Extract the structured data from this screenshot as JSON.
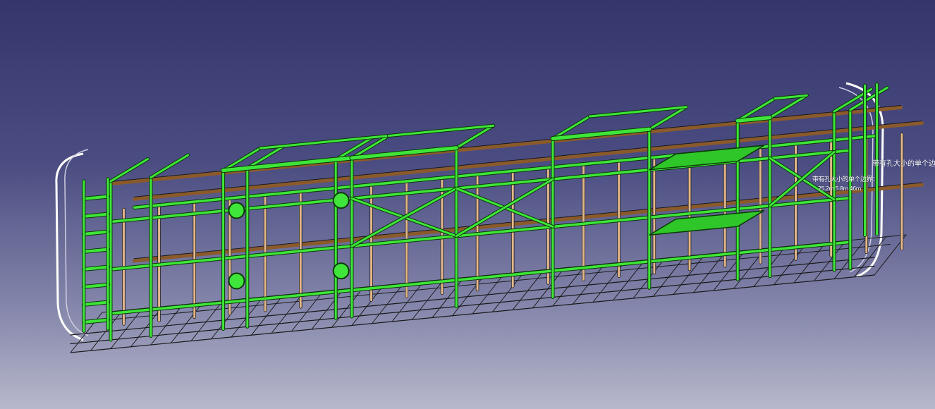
{
  "viewport": {
    "background_top": "#34356b",
    "background_bottom": "#b7b8cb"
  },
  "model": {
    "frame_color": "#3fe53a",
    "frame_edge_color": "#0a3a06",
    "rail_color": "#e3b78a",
    "beam_color": "#8b5a2b",
    "wire_color": "#1a1a1a",
    "shell_color": "#ffffff"
  },
  "annotations": {
    "hole_boundary_label": "带有孔大小的单个边界",
    "hole_boundary_label_overlap": "带有孔大小的单个边界：",
    "dimension_text": "25.2m 5.8m 46m"
  }
}
